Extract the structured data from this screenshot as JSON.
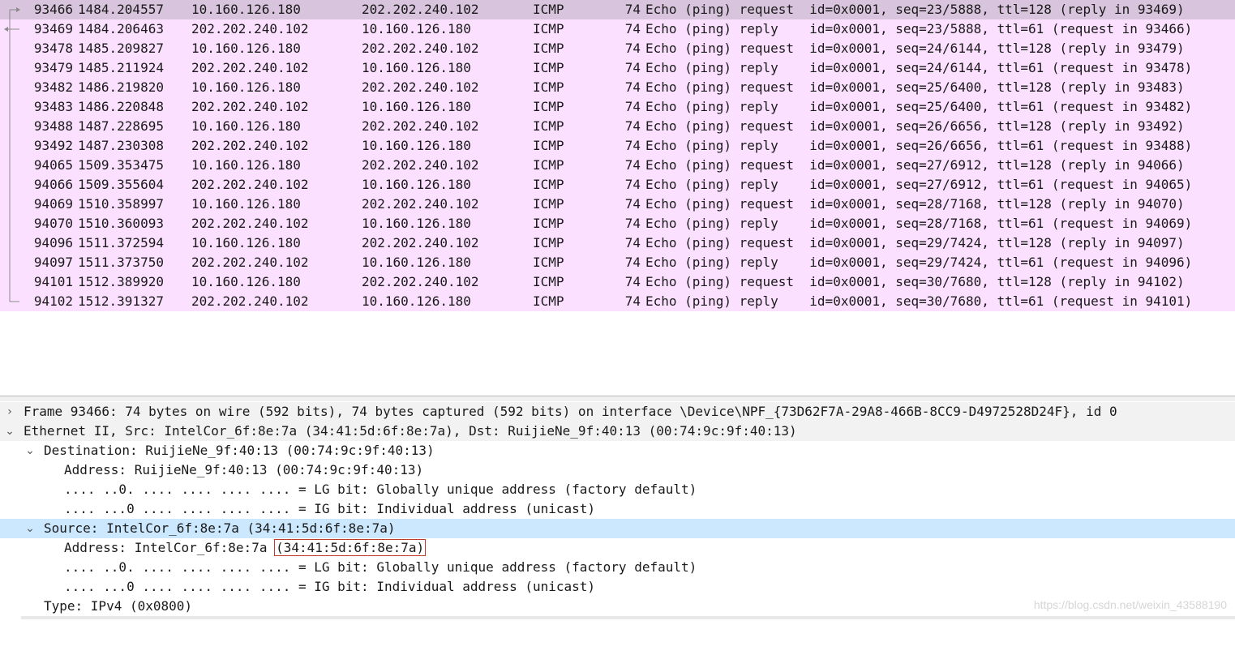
{
  "packets": [
    {
      "no": "93466",
      "time": "1484.204557",
      "src": "10.160.126.180",
      "dst": "202.202.240.102",
      "proto": "ICMP",
      "len": "74",
      "info": "Echo (ping) request  id=0x0001, seq=23/5888, ttl=128 (reply in 93469)",
      "rel": "out",
      "selected": true
    },
    {
      "no": "93469",
      "time": "1484.206463",
      "src": "202.202.240.102",
      "dst": "10.160.126.180",
      "proto": "ICMP",
      "len": "74",
      "info": "Echo (ping) reply    id=0x0001, seq=23/5888, ttl=61 (request in 93466)",
      "rel": "back"
    },
    {
      "no": "93478",
      "time": "1485.209827",
      "src": "10.160.126.180",
      "dst": "202.202.240.102",
      "proto": "ICMP",
      "len": "74",
      "info": "Echo (ping) request  id=0x0001, seq=24/6144, ttl=128 (reply in 93479)",
      "rel": "line"
    },
    {
      "no": "93479",
      "time": "1485.211924",
      "src": "202.202.240.102",
      "dst": "10.160.126.180",
      "proto": "ICMP",
      "len": "74",
      "info": "Echo (ping) reply    id=0x0001, seq=24/6144, ttl=61 (request in 93478)",
      "rel": "line"
    },
    {
      "no": "93482",
      "time": "1486.219820",
      "src": "10.160.126.180",
      "dst": "202.202.240.102",
      "proto": "ICMP",
      "len": "74",
      "info": "Echo (ping) request  id=0x0001, seq=25/6400, ttl=128 (reply in 93483)",
      "rel": "line"
    },
    {
      "no": "93483",
      "time": "1486.220848",
      "src": "202.202.240.102",
      "dst": "10.160.126.180",
      "proto": "ICMP",
      "len": "74",
      "info": "Echo (ping) reply    id=0x0001, seq=25/6400, ttl=61 (request in 93482)",
      "rel": "line"
    },
    {
      "no": "93488",
      "time": "1487.228695",
      "src": "10.160.126.180",
      "dst": "202.202.240.102",
      "proto": "ICMP",
      "len": "74",
      "info": "Echo (ping) request  id=0x0001, seq=26/6656, ttl=128 (reply in 93492)",
      "rel": "line"
    },
    {
      "no": "93492",
      "time": "1487.230308",
      "src": "202.202.240.102",
      "dst": "10.160.126.180",
      "proto": "ICMP",
      "len": "74",
      "info": "Echo (ping) reply    id=0x0001, seq=26/6656, ttl=61 (request in 93488)",
      "rel": "line"
    },
    {
      "no": "94065",
      "time": "1509.353475",
      "src": "10.160.126.180",
      "dst": "202.202.240.102",
      "proto": "ICMP",
      "len": "74",
      "info": "Echo (ping) request  id=0x0001, seq=27/6912, ttl=128 (reply in 94066)",
      "rel": "line"
    },
    {
      "no": "94066",
      "time": "1509.355604",
      "src": "202.202.240.102",
      "dst": "10.160.126.180",
      "proto": "ICMP",
      "len": "74",
      "info": "Echo (ping) reply    id=0x0001, seq=27/6912, ttl=61 (request in 94065)",
      "rel": "line"
    },
    {
      "no": "94069",
      "time": "1510.358997",
      "src": "10.160.126.180",
      "dst": "202.202.240.102",
      "proto": "ICMP",
      "len": "74",
      "info": "Echo (ping) request  id=0x0001, seq=28/7168, ttl=128 (reply in 94070)",
      "rel": "line"
    },
    {
      "no": "94070",
      "time": "1510.360093",
      "src": "202.202.240.102",
      "dst": "10.160.126.180",
      "proto": "ICMP",
      "len": "74",
      "info": "Echo (ping) reply    id=0x0001, seq=28/7168, ttl=61 (request in 94069)",
      "rel": "line"
    },
    {
      "no": "94096",
      "time": "1511.372594",
      "src": "10.160.126.180",
      "dst": "202.202.240.102",
      "proto": "ICMP",
      "len": "74",
      "info": "Echo (ping) request  id=0x0001, seq=29/7424, ttl=128 (reply in 94097)",
      "rel": "line"
    },
    {
      "no": "94097",
      "time": "1511.373750",
      "src": "202.202.240.102",
      "dst": "10.160.126.180",
      "proto": "ICMP",
      "len": "74",
      "info": "Echo (ping) reply    id=0x0001, seq=29/7424, ttl=61 (request in 94096)",
      "rel": "line"
    },
    {
      "no": "94101",
      "time": "1512.389920",
      "src": "10.160.126.180",
      "dst": "202.202.240.102",
      "proto": "ICMP",
      "len": "74",
      "info": "Echo (ping) request  id=0x0001, seq=30/7680, ttl=128 (reply in 94102)",
      "rel": "line"
    },
    {
      "no": "94102",
      "time": "1512.391327",
      "src": "202.202.240.102",
      "dst": "10.160.126.180",
      "proto": "ICMP",
      "len": "74",
      "info": "Echo (ping) reply    id=0x0001, seq=30/7680, ttl=61 (request in 94101)",
      "rel": "end"
    }
  ],
  "details": {
    "frame": "Frame 93466: 74 bytes on wire (592 bits), 74 bytes captured (592 bits) on interface \\Device\\NPF_{73D62F7A-29A8-466B-8CC9-D4972528D24F}, id 0",
    "ethernet": "Ethernet II, Src: IntelCor_6f:8e:7a (34:41:5d:6f:8e:7a), Dst: RuijieNe_9f:40:13 (00:74:9c:9f:40:13)",
    "destination": "Destination: RuijieNe_9f:40:13 (00:74:9c:9f:40:13)",
    "dst_address": "Address: RuijieNe_9f:40:13 (00:74:9c:9f:40:13)",
    "dst_lg": ".... ..0. .... .... .... .... = LG bit: Globally unique address (factory default)",
    "dst_ig": ".... ...0 .... .... .... .... = IG bit: Individual address (unicast)",
    "source": "Source: IntelCor_6f:8e:7a (34:41:5d:6f:8e:7a)",
    "src_address_prefix": "Address: IntelCor_6f:8e:7a ",
    "src_address_mac": "(34:41:5d:6f:8e:7a)",
    "src_lg": ".... ..0. .... .... .... .... = LG bit: Globally unique address (factory default)",
    "src_ig": ".... ...0 .... .... .... .... = IG bit: Individual address (unicast)",
    "type": "Type: IPv4 (0x0800)"
  },
  "watermark": "https://blog.csdn.net/weixin_43588190",
  "colors": {
    "icmp_row": "#fce0ff",
    "selected_row": "#d8c4dc",
    "detail_highlight": "#cce8ff",
    "annotation_box": "#c0392b"
  }
}
